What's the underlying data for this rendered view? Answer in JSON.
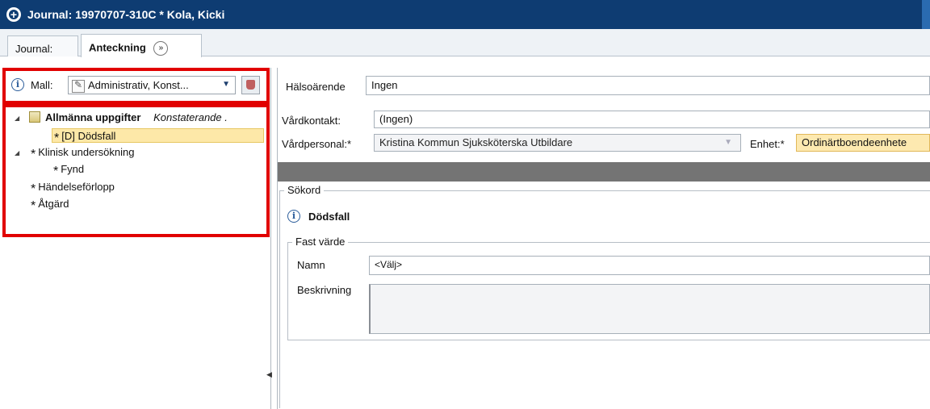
{
  "window": {
    "title": "Journal: 19970707-310C * Kola, Kicki"
  },
  "tabs": [
    {
      "label": "Journal:"
    },
    {
      "label": "Anteckning",
      "extra_icon": "double-chevron-right-icon"
    }
  ],
  "mall": {
    "label": "Mall:",
    "selected": "Administrativ, Konst..."
  },
  "tree": {
    "nodes": [
      {
        "label": "Allmänna uppgifter",
        "sub": "Konstaterande ."
      },
      {
        "label": "[D] Dödsfall"
      },
      {
        "label": "Klinisk undersökning"
      },
      {
        "label": "Fynd"
      },
      {
        "label": "Händelseförlopp"
      },
      {
        "label": "Åtgärd"
      }
    ],
    "star": "*"
  },
  "form": {
    "halsoarende": {
      "label": "Hälsoärende",
      "value": "Ingen"
    },
    "vardkontakt": {
      "label": "Vårdkontakt:",
      "value": "(Ingen)"
    },
    "vardpersonal": {
      "label": "Vårdpersonal:*",
      "value": "Kristina Kommun Sjuksköterska Utbildare"
    },
    "enhet": {
      "label": "Enhet:*",
      "value": "Ordinärtboendeenhete"
    }
  },
  "sokord": {
    "title": "Sökord",
    "term": "Dödsfall",
    "fast_varde": {
      "title": "Fast värde",
      "namn_label": "Namn",
      "namn_value": "<Välj>",
      "beskrivning_label": "Beskrivning"
    }
  },
  "colors": {
    "titlebar": "#0e3c72",
    "highlight": "#e10000",
    "selection": "#fde8a8"
  }
}
